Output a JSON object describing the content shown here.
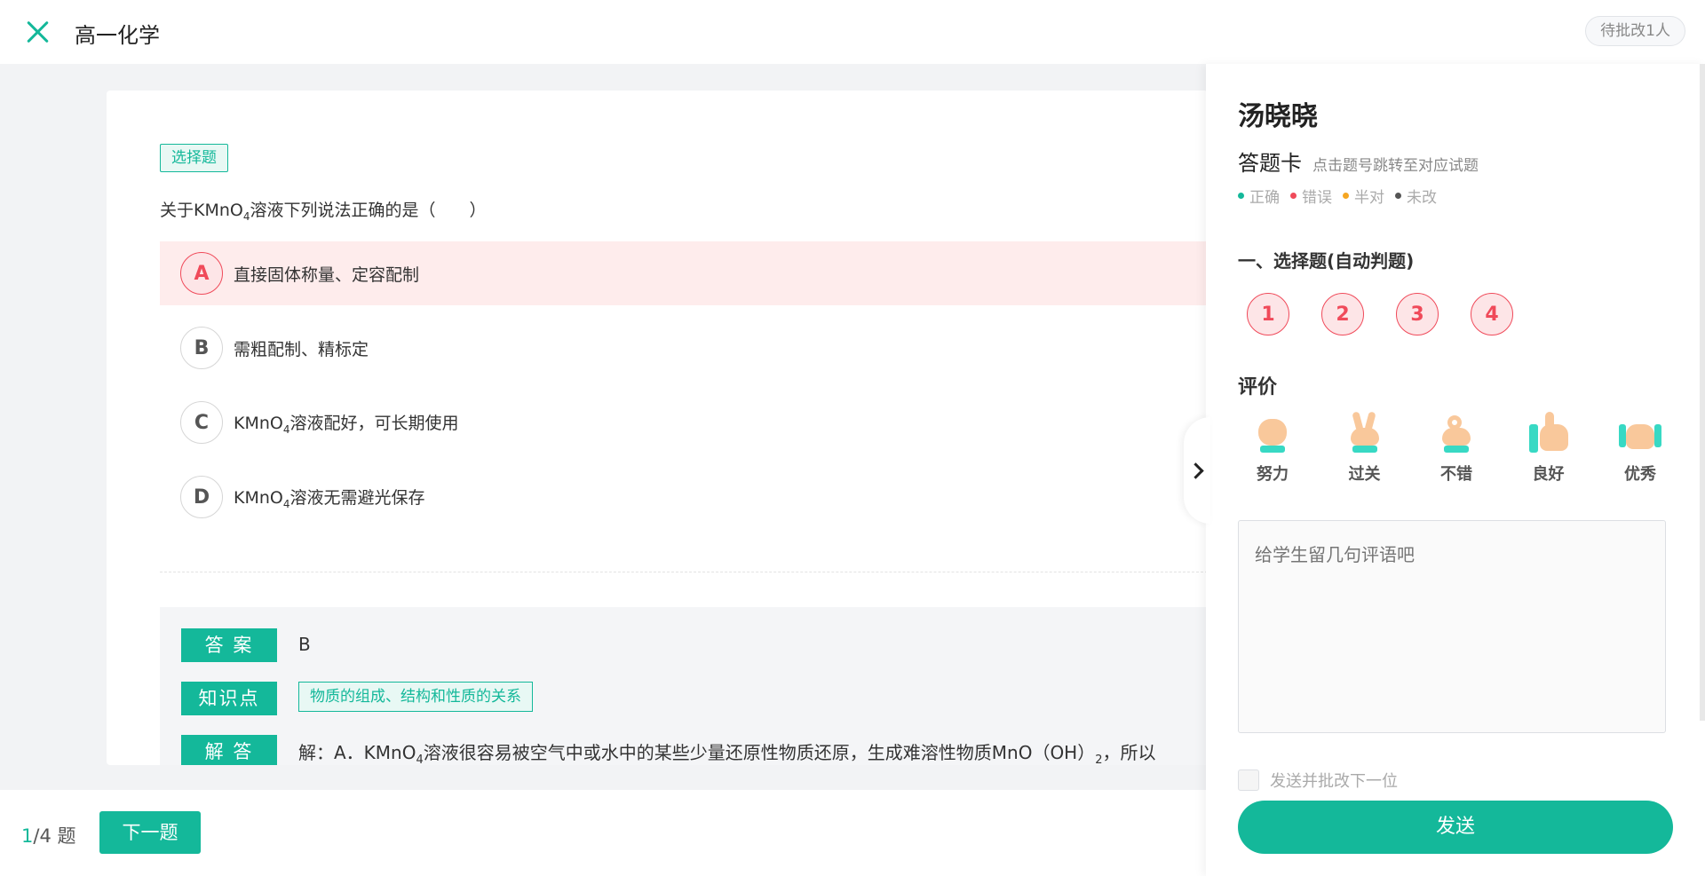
{
  "header": {
    "title": "高一化学",
    "pending": "待批改1人"
  },
  "question": {
    "type_tag": "选择题",
    "stem_pre": "关于KMnO",
    "stem_sub": "4",
    "stem_post": "溶液下列说法正确的是（　　）",
    "options": [
      {
        "letter": "A",
        "pre": "直接固体称量、定容配制",
        "sub": "",
        "post": ""
      },
      {
        "letter": "B",
        "pre": "需粗配制、精标定",
        "sub": "",
        "post": ""
      },
      {
        "letter": "C",
        "pre": "KMnO",
        "sub": "4",
        "post": "溶液配好，可长期使用"
      },
      {
        "letter": "D",
        "pre": "KMnO",
        "sub": "4",
        "post": "溶液无需避光保存"
      }
    ]
  },
  "analysis": {
    "answer_label": "答 案",
    "answer_value": "B",
    "kp_label": "知识点",
    "kp_value": "物质的组成、结构和性质的关系",
    "solution_label": "解 答",
    "solution_pre": "解：A．KMnO",
    "solution_sub1": "4",
    "solution_mid": "溶液很容易被空气中或水中的某些少量还原性物质还原，生成难溶性物质MnO（OH）",
    "solution_sub2": "2",
    "solution_post": "，所以"
  },
  "pager": {
    "current": "1",
    "total": "/4 题",
    "next_label": "下一题"
  },
  "panel": {
    "student_name": "汤晓晓",
    "card_title": "答题卡",
    "card_hint": "点击题号跳转至对应试题",
    "legend": [
      {
        "label": "正确",
        "color": "#14b89a"
      },
      {
        "label": "错误",
        "color": "#f04a5a"
      },
      {
        "label": "半对",
        "color": "#f5a623"
      },
      {
        "label": "未改",
        "color": "#555555"
      }
    ],
    "section_title": "一、选择题(自动判题)",
    "question_numbers": [
      "1",
      "2",
      "3",
      "4"
    ],
    "eval_title": "评价",
    "ratings": [
      {
        "label": "努力",
        "icon": "fist-icon"
      },
      {
        "label": "过关",
        "icon": "victory-hand-icon"
      },
      {
        "label": "不错",
        "icon": "ok-hand-icon"
      },
      {
        "label": "良好",
        "icon": "thumbs-up-icon"
      },
      {
        "label": "优秀",
        "icon": "rock-hand-icon"
      }
    ],
    "comment_placeholder": "给学生留几句评语吧",
    "checkbox_label": "发送并批改下一位",
    "send_label": "发送"
  }
}
